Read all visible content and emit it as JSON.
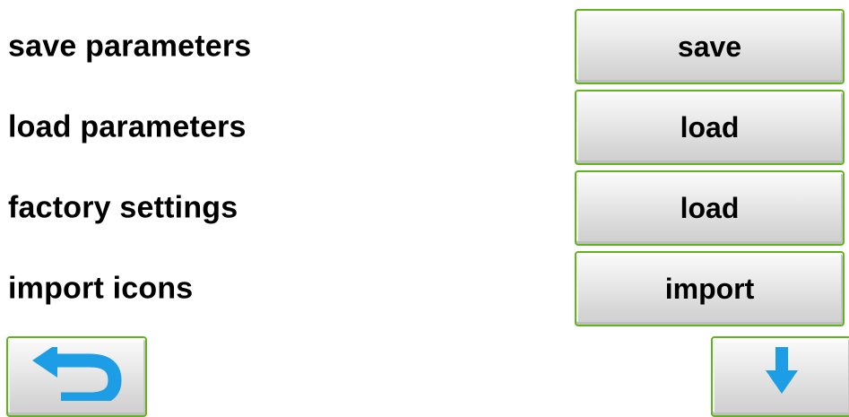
{
  "rows": [
    {
      "label": "save parameters",
      "button": "save"
    },
    {
      "label": "load parameters",
      "button": "load"
    },
    {
      "label": "factory settings",
      "button": "load"
    },
    {
      "label": "import icons",
      "button": "import"
    }
  ],
  "nav": {
    "back_icon": "back-arrow-icon",
    "down_icon": "down-arrow-icon"
  },
  "colors": {
    "button_border": "#5fb51c",
    "icon_blue": "#1c9de6"
  }
}
